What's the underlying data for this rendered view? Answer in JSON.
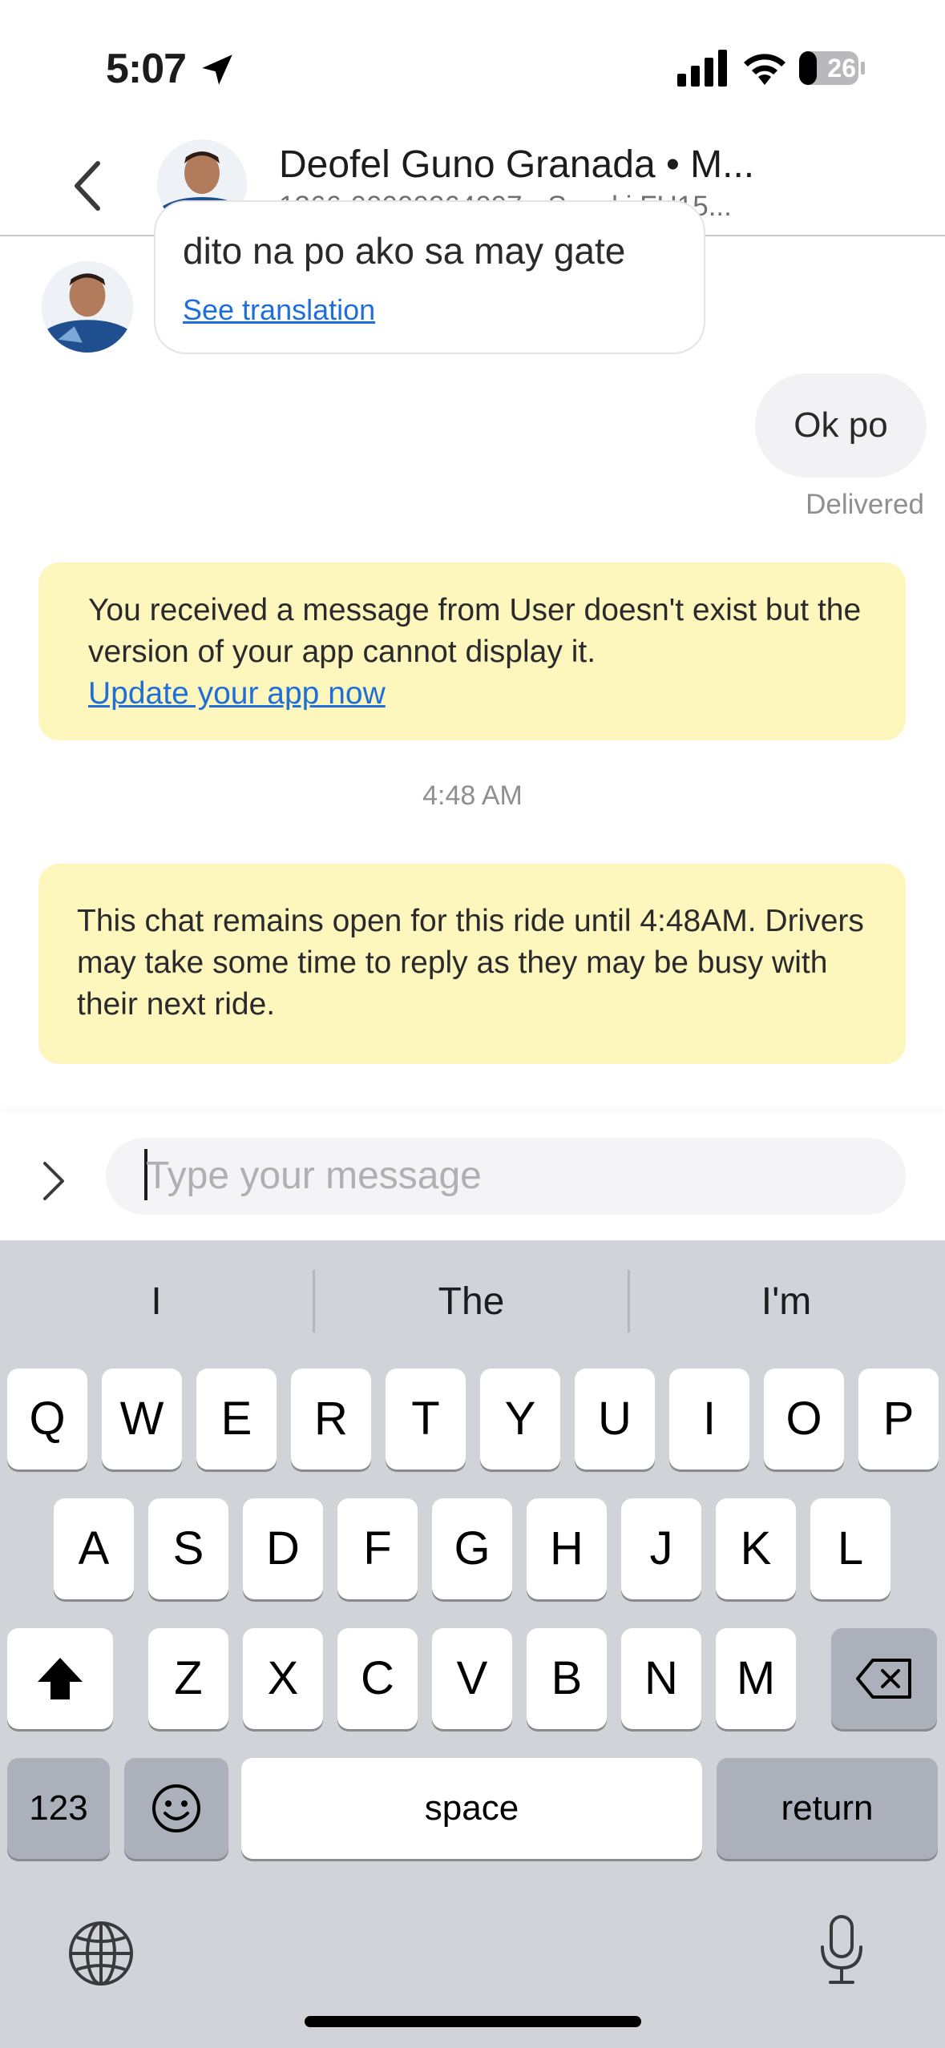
{
  "status_bar": {
    "time": "5:07",
    "battery": "26",
    "icons": [
      "location-arrow-icon",
      "cellular-signal-icon",
      "wifi-icon",
      "battery-icon"
    ]
  },
  "header": {
    "driver_name": "Deofel Guno Granada • M...",
    "driver_subtitle": "1366-00000264097 • Suzuki FU15..."
  },
  "messages": {
    "incoming_text": "dito na po ako sa may gate",
    "see_translation": "See translation",
    "outgoing_text": "Ok po",
    "delivered": "Delivered",
    "notice_1": "You received a message from User doesn't exist but the version of your app cannot display it.",
    "update_link": "Update your app now",
    "timestamp": "4:48 AM",
    "notice_2": "This chat remains open for this ride until 4:48AM. Drivers may take some time to reply as they may be busy with their next ride."
  },
  "composer": {
    "placeholder": "Type your message"
  },
  "keyboard": {
    "suggestions": [
      "I",
      "The",
      "I'm"
    ],
    "row1": [
      "Q",
      "W",
      "E",
      "R",
      "T",
      "Y",
      "U",
      "I",
      "O",
      "P"
    ],
    "row2": [
      "A",
      "S",
      "D",
      "F",
      "G",
      "H",
      "J",
      "K",
      "L"
    ],
    "row3": [
      "Z",
      "X",
      "C",
      "V",
      "B",
      "N",
      "M"
    ],
    "numbers_label": "123",
    "space_label": "space",
    "return_label": "return"
  },
  "colors": {
    "link": "#1e6fd9",
    "notice_bg": "#fdf6bd",
    "keyboard_bg": "#d1d3d9"
  }
}
